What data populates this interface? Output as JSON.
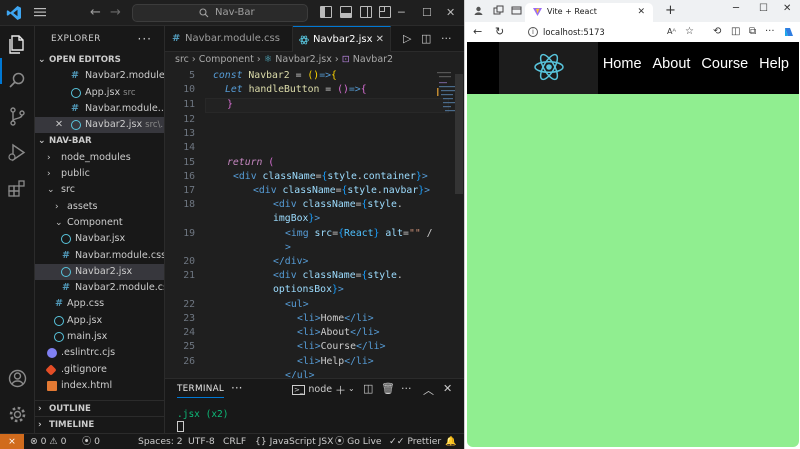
{
  "vscode": {
    "title_search": "Nav-Bar",
    "explorer": {
      "header": "EXPLORER",
      "open_editors": "OPEN EDITORS",
      "open_files": [
        {
          "name": "Navbar2.module...",
          "sub": ""
        },
        {
          "name": "App.jsx",
          "sub": "src"
        },
        {
          "name": "Navbar.module....",
          "sub": ""
        },
        {
          "name": "Navbar2.jsx",
          "sub": "src\\..."
        }
      ],
      "project": "NAV-BAR",
      "tree": [
        {
          "name": "node_modules",
          "type": "folder"
        },
        {
          "name": "public",
          "type": "folder"
        },
        {
          "name": "src",
          "type": "folder-open"
        },
        {
          "name": "assets",
          "type": "folder"
        },
        {
          "name": "Component",
          "type": "folder-open"
        },
        {
          "name": "Navbar.jsx",
          "type": "react"
        },
        {
          "name": "Navbar.module.css",
          "type": "css"
        },
        {
          "name": "Navbar2.jsx",
          "type": "react"
        },
        {
          "name": "Navbar2.module.css",
          "type": "css"
        },
        {
          "name": "App.css",
          "type": "css"
        },
        {
          "name": "App.jsx",
          "type": "react"
        },
        {
          "name": "main.jsx",
          "type": "react"
        },
        {
          "name": ".eslintrc.cjs",
          "type": "eslint"
        },
        {
          "name": ".gitignore",
          "type": "git"
        },
        {
          "name": "index.html",
          "type": "html"
        }
      ],
      "outline": "OUTLINE",
      "timeline": "TIMELINE"
    },
    "tabs": [
      {
        "label": "Navbar.module.css"
      },
      {
        "label": "Navbar2.jsx"
      }
    ],
    "breadcrumb": [
      "src",
      "Component",
      "Navbar2.jsx",
      "Navbar2"
    ],
    "line_numbers": [
      "5",
      "10",
      "11",
      "12",
      "13",
      "14",
      "15",
      "16",
      "17",
      "18",
      "",
      "19",
      "",
      "20",
      "21",
      "",
      "22",
      "23",
      "24",
      "25",
      "26"
    ],
    "panel": {
      "title": "TERMINAL",
      "shell": "node",
      "output": ".jsx (x2)"
    },
    "status": {
      "errors": "0",
      "warnings": "0",
      "ports": "0",
      "spaces": "Spaces: 2",
      "encoding": "UTF-8",
      "eol": "CRLF",
      "language": "JavaScript JSX",
      "golive": "Go Live",
      "prettier": "Prettier"
    }
  },
  "browser": {
    "tab_title": "Vite + React",
    "url": "localhost:5173",
    "nav_items": [
      "Home",
      "About",
      "Course",
      "Help"
    ],
    "colors": {
      "page_bg": "#90ee90",
      "navbar_bg": "#000000",
      "react_logo": "#58c4dc"
    }
  }
}
